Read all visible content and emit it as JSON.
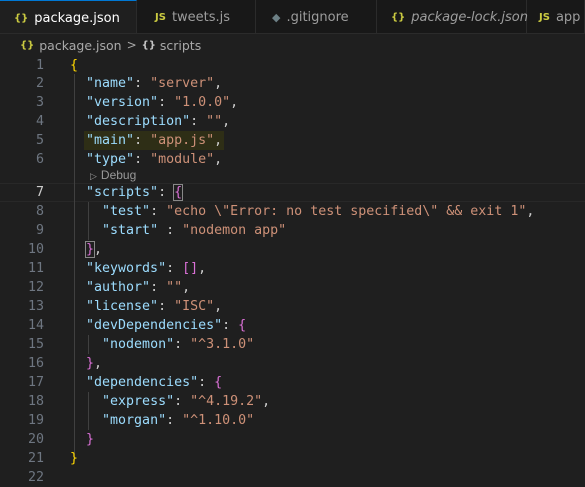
{
  "tabs": [
    {
      "icon": "{}",
      "label": "package.json"
    },
    {
      "icon": "JS",
      "label": "tweets.js"
    },
    {
      "icon": "◆",
      "label": ".gitignore"
    },
    {
      "icon": "{}",
      "label": "package-lock.json"
    },
    {
      "icon": "JS",
      "label": "app"
    }
  ],
  "breadcrumb": {
    "file_icon": "{}",
    "file": "package.json",
    "separator": ">",
    "section_icon": "{}",
    "section": "scripts"
  },
  "codelens": {
    "icon": "play-icon",
    "label": "Debug"
  },
  "line_numbers": [
    "1",
    "2",
    "3",
    "4",
    "5",
    "6",
    "7",
    "8",
    "9",
    "10",
    "11",
    "12",
    "13",
    "14",
    "15",
    "16",
    "17",
    "18",
    "19",
    "20",
    "21",
    "22"
  ],
  "code": {
    "name_key": "\"name\"",
    "name_val": "\"server\"",
    "version_key": "\"version\"",
    "version_val": "\"1.0.0\"",
    "description_key": "\"description\"",
    "description_val": "\"\"",
    "main_key": "\"main\"",
    "main_val": "\"app.js\"",
    "type_key": "\"type\"",
    "type_val": "\"module\"",
    "scripts_key": "\"scripts\"",
    "test_key": "\"test\"",
    "test_val": "\"echo \\\"Error: no test specified\\\" && exit 1\"",
    "start_key": "\"start\"",
    "start_val": "\"nodemon app\"",
    "keywords_key": "\"keywords\"",
    "keywords_val": "[]",
    "author_key": "\"author\"",
    "author_val": "\"\"",
    "license_key": "\"license\"",
    "license_val": "\"ISC\"",
    "devdeps_key": "\"devDependencies\"",
    "nodemon_key": "\"nodemon\"",
    "nodemon_val": "\"^3.1.0\"",
    "deps_key": "\"dependencies\"",
    "express_key": "\"express\"",
    "express_val": "\"^4.19.2\"",
    "morgan_key": "\"morgan\"",
    "morgan_val": "\"^1.10.0\""
  },
  "colors": {
    "key": "#9cdcfe",
    "string": "#ce9178",
    "bracket1": "#ffd700",
    "bracket2": "#da70d6",
    "bracket3": "#179fff",
    "accent": "#0078d4"
  }
}
